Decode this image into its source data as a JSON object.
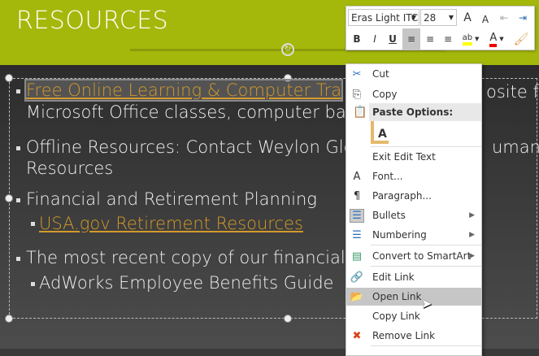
{
  "slide": {
    "title": "RESOURCES",
    "lines": [
      "Free Online Learning & Computer Tra",
      "osite for",
      "Microsoft Office classes,  computer bas",
      "Offline Resources: Contact Weylon Gle",
      "uman",
      "Resources",
      "Financial and Retirement Planning",
      "USA.gov Retirement Resources",
      "The most recent copy of our financial r",
      "AdWorks Employee Benefits Guide"
    ]
  },
  "toolbar": {
    "font": "Eras Light ITC",
    "size": "28",
    "grow": "A",
    "shrink": "A",
    "bold": "B",
    "italic": "I",
    "underline": "U",
    "font_color": "A"
  },
  "menu": {
    "cut": "Cut",
    "copy": "Copy",
    "paste_options": "Paste Options:",
    "exit_edit": "Exit Edit Text",
    "font": "Font...",
    "paragraph": "Paragraph...",
    "bullets": "Bullets",
    "numbering": "Numbering",
    "smartart": "Convert to SmartArt",
    "edit_link": "Edit Link",
    "open_link": "Open Link",
    "copy_link": "Copy Link",
    "remove_link": "Remove Link"
  },
  "colors": {
    "header": "#a4b80c",
    "link": "#d39a2a"
  }
}
